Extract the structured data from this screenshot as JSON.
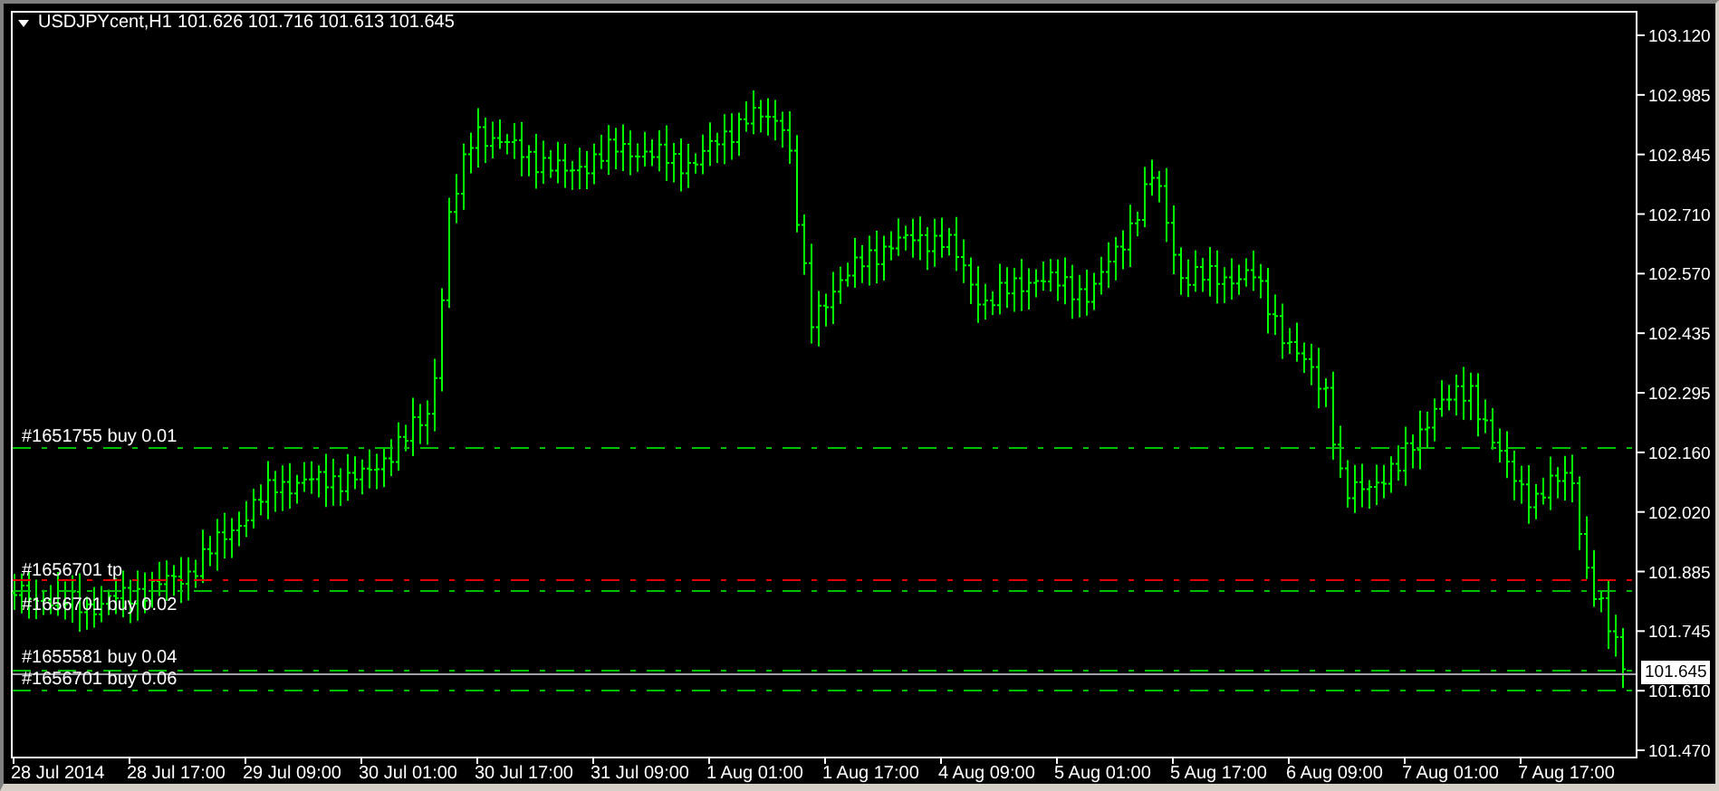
{
  "chart": {
    "title": "USDJPYcent,H1",
    "ohlc": "101.626 101.716 101.613 101.645",
    "price_axis": [
      "103.120",
      "102.985",
      "102.845",
      "102.710",
      "102.570",
      "102.435",
      "102.295",
      "102.160",
      "102.020",
      "101.885",
      "101.745",
      "101.610",
      "101.470"
    ],
    "time_axis": [
      "28 Jul 2014",
      "28 Jul 17:00",
      "29 Jul 09:00",
      "30 Jul 01:00",
      "30 Jul 17:00",
      "31 Jul 09:00",
      "1 Aug 01:00",
      "1 Aug 17:00",
      "4 Aug 09:00",
      "5 Aug 01:00",
      "5 Aug 17:00",
      "6 Aug 09:00",
      "7 Aug 01:00",
      "7 Aug 17:00"
    ],
    "orders": [
      {
        "label": "#1651755 buy 0.01",
        "color": "#00c000"
      },
      {
        "label": "#1656701 tp",
        "color": "#e00000"
      },
      {
        "label": "#1656701 buy 0.02",
        "color": "#00c000"
      },
      {
        "label": "#1655581 buy 0.04",
        "color": "#00c000"
      },
      {
        "label": "#1656701 buy 0.06",
        "color": "#00c000"
      }
    ],
    "current_price": "101.645"
  }
}
